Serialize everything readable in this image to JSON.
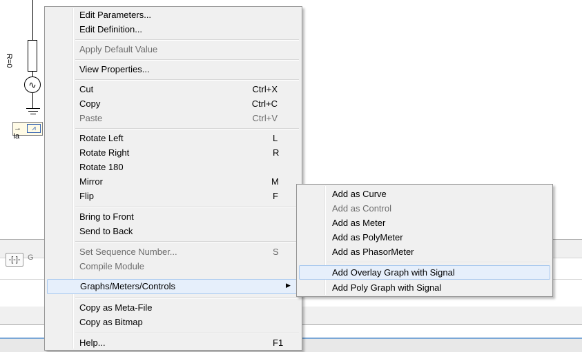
{
  "schematic": {
    "resistor_label": "R=0",
    "source_symbol": "∿",
    "meter_symbol": "⩘",
    "meter_arrow": "→",
    "current_label": "Ia"
  },
  "toolbar": {
    "mini_button": "-[-]-",
    "mini_label": "G"
  },
  "context_menu": {
    "items": [
      {
        "label": "Edit Parameters...",
        "shortcut": ""
      },
      {
        "label": "Edit Definition...",
        "shortcut": ""
      },
      {
        "label": "Apply Default Value",
        "shortcut": ""
      },
      {
        "label": "View Properties...",
        "shortcut": ""
      },
      {
        "label": "Cut",
        "shortcut": "Ctrl+X"
      },
      {
        "label": "Copy",
        "shortcut": "Ctrl+C"
      },
      {
        "label": "Paste",
        "shortcut": "Ctrl+V"
      },
      {
        "label": "Rotate Left",
        "shortcut": "L"
      },
      {
        "label": "Rotate Right",
        "shortcut": "R"
      },
      {
        "label": "Rotate 180",
        "shortcut": ""
      },
      {
        "label": "Mirror",
        "shortcut": "M"
      },
      {
        "label": "Flip",
        "shortcut": "F"
      },
      {
        "label": "Bring to Front",
        "shortcut": ""
      },
      {
        "label": "Send to Back",
        "shortcut": ""
      },
      {
        "label": "Set Sequence Number...",
        "shortcut": "S"
      },
      {
        "label": "Compile Module",
        "shortcut": ""
      },
      {
        "label": "Graphs/Meters/Controls",
        "shortcut": "▶"
      },
      {
        "label": "Copy as Meta-File",
        "shortcut": ""
      },
      {
        "label": "Copy as Bitmap",
        "shortcut": ""
      },
      {
        "label": "Help...",
        "shortcut": "F1"
      }
    ]
  },
  "submenu": {
    "items": [
      {
        "label": "Add as Curve"
      },
      {
        "label": "Add as Control"
      },
      {
        "label": "Add as Meter"
      },
      {
        "label": "Add as PolyMeter"
      },
      {
        "label": "Add as PhasorMeter"
      },
      {
        "label": "Add Overlay Graph with Signal"
      },
      {
        "label": "Add Poly Graph with Signal"
      }
    ]
  },
  "colors": {
    "menu_bg": "#f0f0f0",
    "highlight_bg": "#e6effb",
    "highlight_border": "#a8c8ee",
    "disabled_text": "#6d6d6d"
  }
}
